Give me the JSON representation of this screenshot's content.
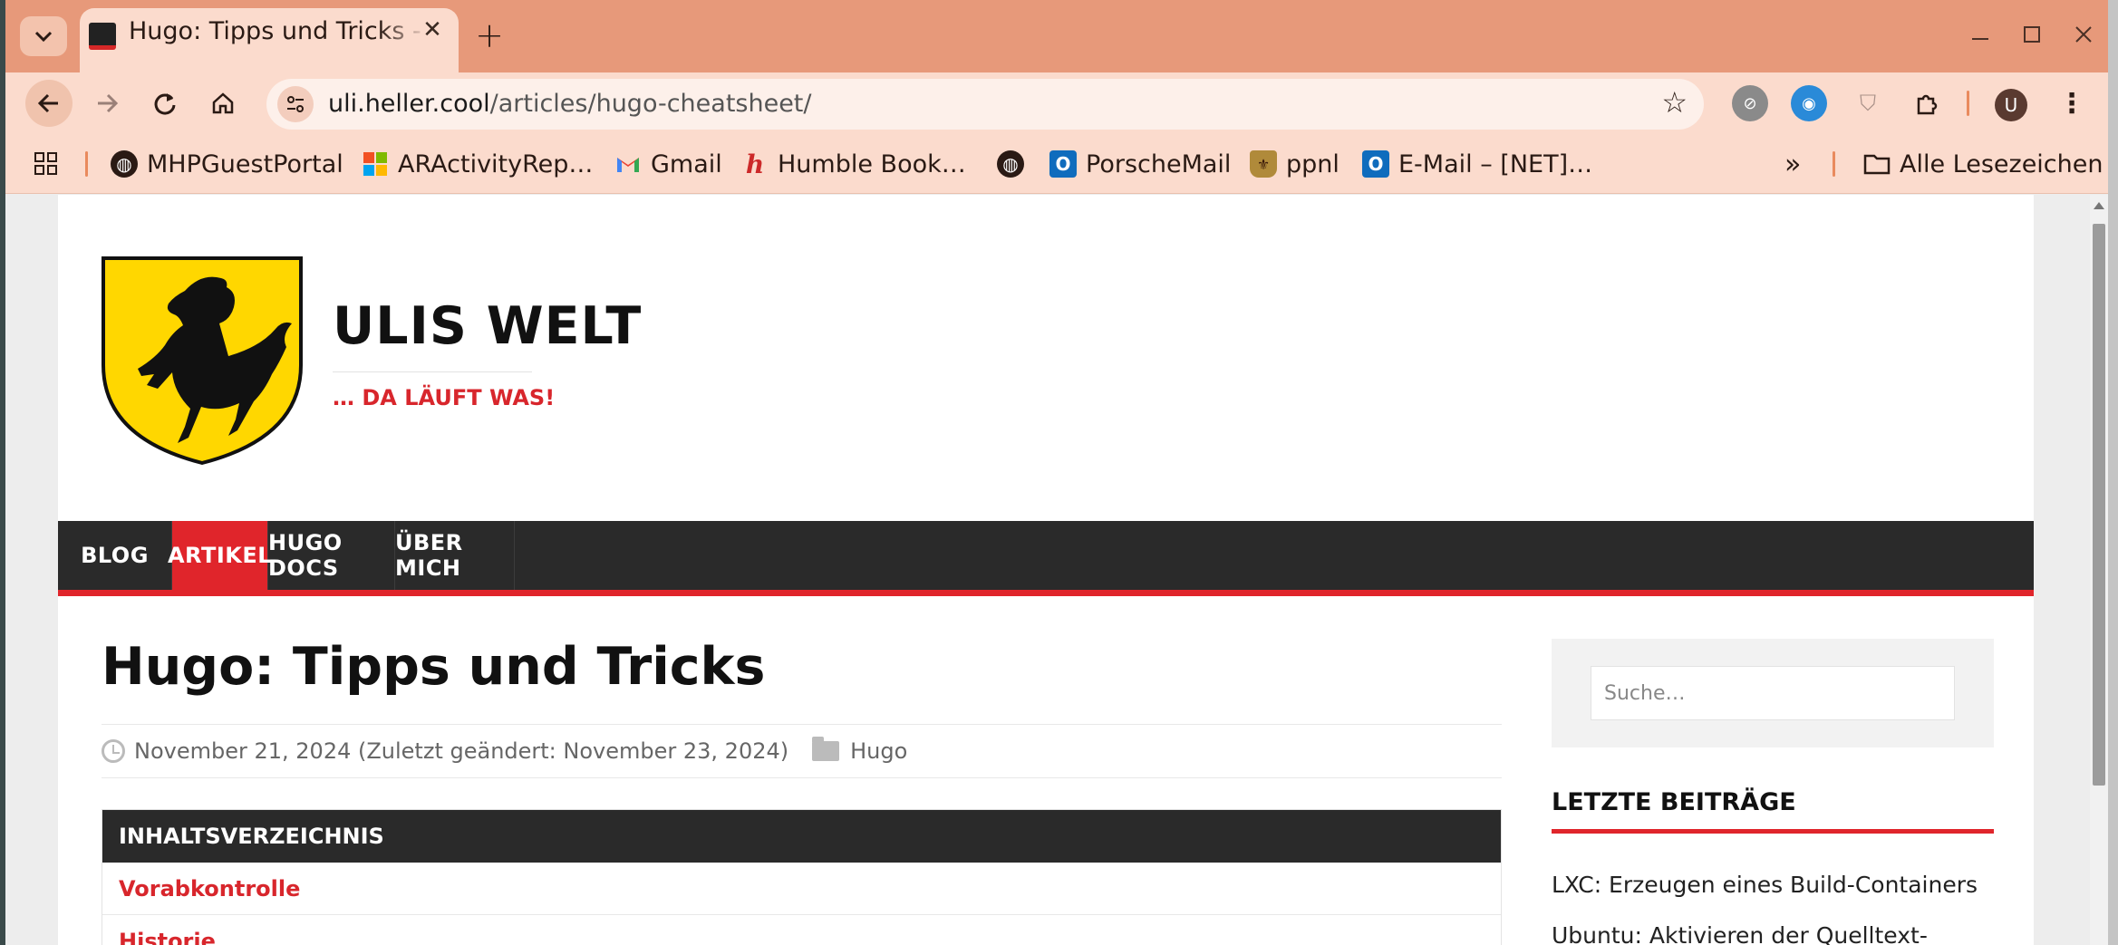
{
  "browser": {
    "tab_title": "Hugo: Tipps und Tricks - Ulis Welt",
    "url_host": "uli.heller.cool",
    "url_path": "/articles/hugo-cheatsheet/",
    "profile_initial": "U",
    "accent_color": "#e7997a"
  },
  "bookmarks": [
    {
      "label": "MHPGuestPortal",
      "icon": "globe-icon"
    },
    {
      "label": "ARActivityRep…",
      "icon": "microsoft-icon"
    },
    {
      "label": "Gmail",
      "icon": "gmail-icon"
    },
    {
      "label": "Humble Book…",
      "icon": "humble-icon"
    },
    {
      "label": "",
      "icon": "globe-icon"
    },
    {
      "label": "PorscheMail",
      "icon": "outlook-icon"
    },
    {
      "label": "ppnl",
      "icon": "porsche-icon"
    },
    {
      "label": "E-Mail – [NET]…",
      "icon": "outlook-icon"
    }
  ],
  "bookmarks_more": "»",
  "all_bookmarks": "Alle Lesezeichen",
  "site": {
    "title": "ULIS WELT",
    "tagline": "… DA LÄUFT WAS!",
    "brand_color": "#e0252b"
  },
  "nav": [
    "BLOG",
    "ARTIKEL",
    "HUGO DOCS",
    "ÜBER MICH"
  ],
  "nav_active": "ARTIKEL",
  "post": {
    "title": "Hugo: Tipps und Tricks",
    "date": "November 21, 2024 (Zuletzt geändert: November 23, 2024)",
    "category": "Hugo"
  },
  "toc": {
    "heading": "INHALTSVERZEICHNIS",
    "items": [
      "Vorabkontrolle",
      "Historie"
    ]
  },
  "sidebar": {
    "search_placeholder": "Suche…",
    "recent_heading": "LETZTE BEITRÄGE",
    "recent_posts": [
      "LXC: Erzeugen eines Build-Containers",
      "Ubuntu: Aktivieren der Quelltext-"
    ]
  }
}
